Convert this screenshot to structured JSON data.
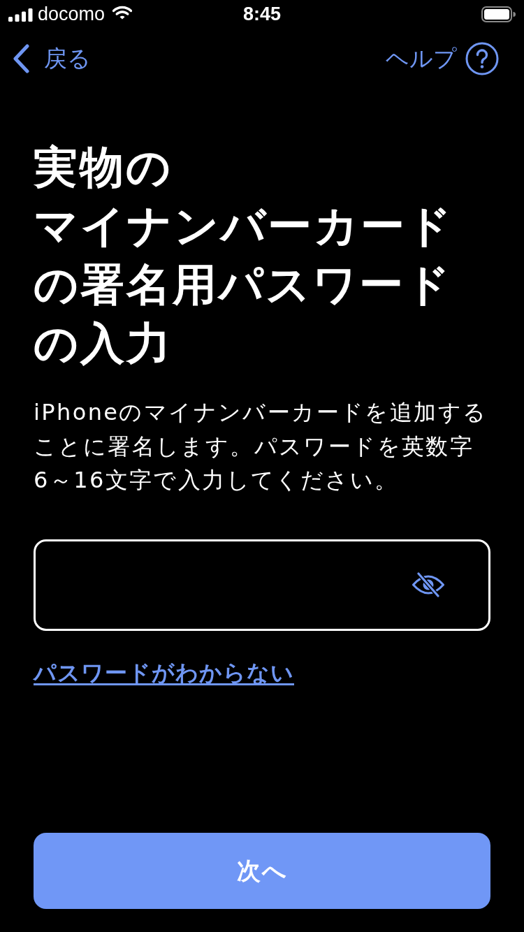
{
  "status_bar": {
    "carrier": "docomo",
    "time": "8:45"
  },
  "nav": {
    "back": "戻る",
    "help": "ヘルプ"
  },
  "title_lines": [
    "実物の",
    "マイナンバーカード",
    "の署名用パスワード",
    "の入力"
  ],
  "description_lines": [
    "iPhoneのマイナンバーカードを追加する",
    "ことに署名します。パスワードを英数字",
    "6～16文字で入力してください。"
  ],
  "password_field": {
    "masked": true
  },
  "forgot_link": "パスワードがわからない",
  "next_button": "次へ"
}
